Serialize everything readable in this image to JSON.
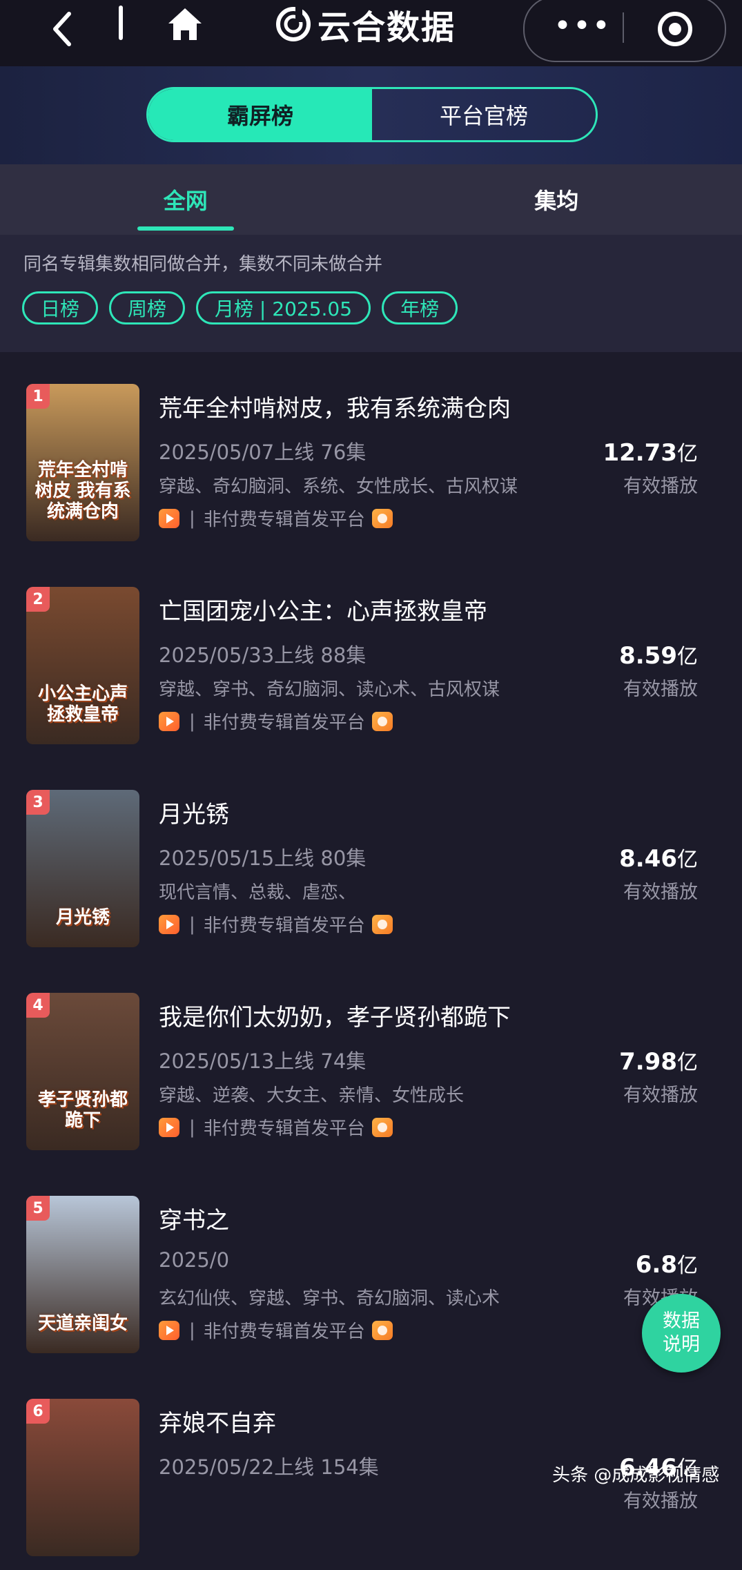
{
  "nav": {
    "app_title": "云合数据",
    "more_icon": "ellipsis-icon",
    "target_icon": "close-mini-program-icon"
  },
  "segment": {
    "left": "霸屏榜",
    "right": "平台官榜"
  },
  "tabs": [
    "全网",
    "集均"
  ],
  "note": "同名专辑集数相同做合并，集数不同未做合并",
  "chips": [
    "日榜",
    "周榜",
    "月榜 | 2025.05",
    "年榜"
  ],
  "items": [
    {
      "rank": "1",
      "title": "荒年全村啃树皮，我有系统满仓肉",
      "date": "2025/05/07上线 76集",
      "tags": "穿越、奇幻脑洞、系统、女性成长、古风权谋",
      "platform": "非付费专辑首发平台",
      "value": "12.73",
      "unit": "亿",
      "label": "有效播放",
      "poster_text": "荒年全村啃树皮 我有系统满仓肉",
      "poster_bg": "#c99a5b"
    },
    {
      "rank": "2",
      "title": "亡国团宠小公主：心声拯救皇帝",
      "date": "2025/05/33上线 88集",
      "tags": "穿越、穿书、奇幻脑洞、读心术、古风权谋",
      "platform": "非付费专辑首发平台",
      "value": "8.59",
      "unit": "亿",
      "label": "有效播放",
      "poster_text": "小公主心声 拯救皇帝",
      "poster_bg": "#7a4a30"
    },
    {
      "rank": "3",
      "title": "月光锈",
      "date": "2025/05/15上线 80集",
      "tags": "现代言情、总裁、虐恋、",
      "platform": "非付费专辑首发平台",
      "value": "8.46",
      "unit": "亿",
      "label": "有效播放",
      "poster_text": "月光锈",
      "poster_bg": "#5e6a78"
    },
    {
      "rank": "4",
      "title": "我是你们太奶奶，孝子贤孙都跪下",
      "date": "2025/05/13上线 74集",
      "tags": "穿越、逆袭、大女主、亲情、女性成长",
      "platform": "非付费专辑首发平台",
      "value": "7.98",
      "unit": "亿",
      "label": "有效播放",
      "poster_text": "孝子贤孙都跪下",
      "poster_bg": "#6b4a3a"
    },
    {
      "rank": "5",
      "title": "穿书之",
      "date": "2025/0",
      "tags": "玄幻仙侠、穿越、穿书、奇幻脑洞、读心术",
      "platform": "非付费专辑首发平台",
      "value": "6.8",
      "unit": "亿",
      "label": "有效播放",
      "poster_text": "天道亲闺女",
      "poster_bg": "#b8c6d8"
    },
    {
      "rank": "6",
      "title": "弃娘不自弃",
      "date": "2025/05/22上线 154集",
      "tags": "",
      "platform": "",
      "value": "6.46",
      "unit": "亿",
      "label": "有效播放",
      "poster_text": "",
      "poster_bg": "#8a4a3a"
    }
  ],
  "fab": {
    "line1": "数据",
    "line2": "说明"
  },
  "watermark": "头条 @成成影视情感",
  "colors": {
    "accent": "#2ee6b8",
    "background": "#1c1b2a",
    "rank_badge": "#e85b5b"
  }
}
